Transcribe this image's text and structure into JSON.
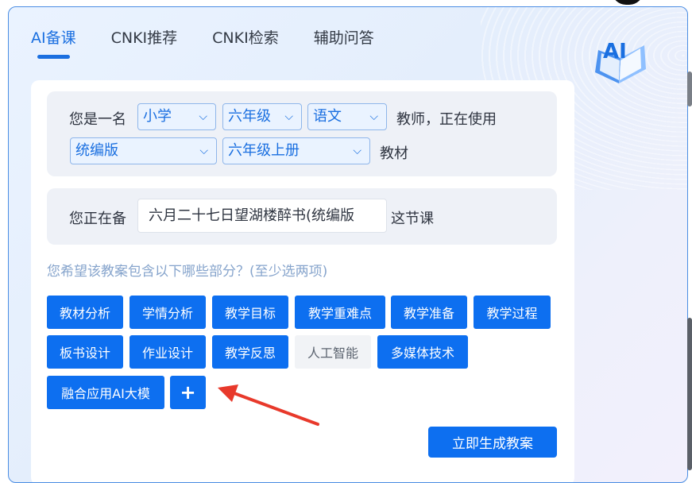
{
  "tabs": [
    {
      "label": "AI备课",
      "active": true
    },
    {
      "label": "CNKI推荐",
      "active": false
    },
    {
      "label": "CNKI检索",
      "active": false
    },
    {
      "label": "辅助问答",
      "active": false
    }
  ],
  "logo": {
    "text": "AI"
  },
  "profile": {
    "prefix": "您是一名",
    "level": "小学",
    "grade": "六年级",
    "subject": "语文",
    "role_suffix": "教师，正在使用",
    "edition": "统编版",
    "volume": "六年级上册",
    "material_suffix": "教材"
  },
  "lesson": {
    "prefix": "您正在备",
    "value": "六月二十七日望湖楼醉书(统编版",
    "suffix": "这节课"
  },
  "sections_prompt": "您希望该教案包含以下哪些部分？(至少选两项)",
  "sections": [
    {
      "label": "教材分析",
      "selected": true
    },
    {
      "label": "学情分析",
      "selected": true
    },
    {
      "label": "教学目标",
      "selected": true
    },
    {
      "label": "教学重难点",
      "selected": true
    },
    {
      "label": "教学准备",
      "selected": true
    },
    {
      "label": "教学过程",
      "selected": true
    },
    {
      "label": "板书设计",
      "selected": true
    },
    {
      "label": "作业设计",
      "selected": true
    },
    {
      "label": "教学反思",
      "selected": true
    },
    {
      "label": "人工智能",
      "selected": false
    },
    {
      "label": "多媒体技术",
      "selected": true
    },
    {
      "label": "融合应用AI大模",
      "selected": true
    }
  ],
  "add_label": "+",
  "generate_label": "立即生成教案",
  "colors": {
    "accent": "#0d6ff0",
    "arrow": "#e8392b"
  }
}
